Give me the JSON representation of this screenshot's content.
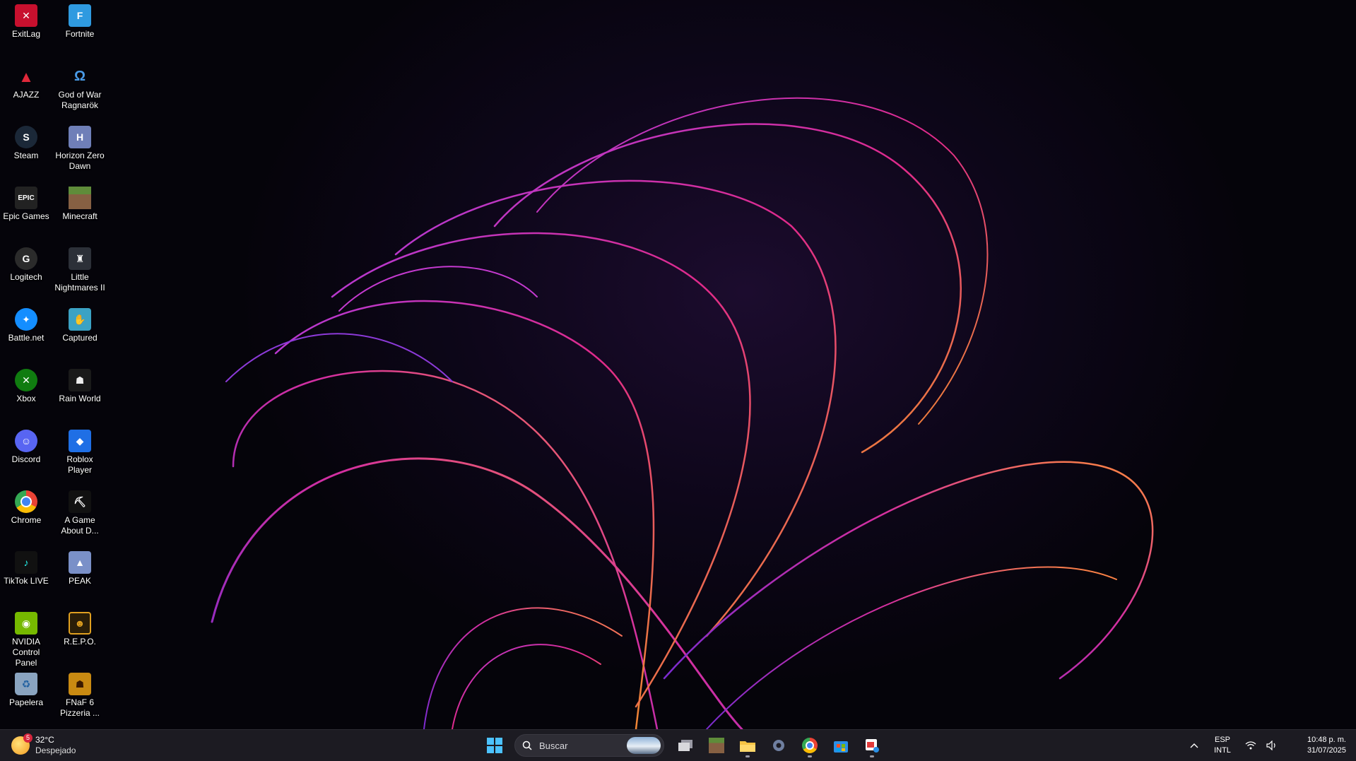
{
  "desktop_icons": [
    {
      "label": "ExitLag",
      "icon": "exitlag-icon",
      "color": "#c8102e"
    },
    {
      "label": "Fortnite",
      "icon": "fortnite-icon",
      "color": "#2f9ae0"
    },
    {
      "label": "AJAZZ",
      "icon": "ajazz-icon",
      "color": "#b3162a"
    },
    {
      "label": "God of War Ragnarök",
      "icon": "god-of-war-icon",
      "color": "#1f4f8c"
    },
    {
      "label": "Steam",
      "icon": "steam-icon",
      "color": "#1b2838"
    },
    {
      "label": "Horizon Zero Dawn",
      "icon": "horizon-icon",
      "color": "#6f7fb8"
    },
    {
      "label": "Epic Games",
      "icon": "epic-games-icon",
      "color": "#222222"
    },
    {
      "label": "Minecraft",
      "icon": "minecraft-icon",
      "color": "#5f8c3a"
    },
    {
      "label": "Logitech",
      "icon": "logitech-icon",
      "color": "#2b2b2b"
    },
    {
      "label": "Little Nightmares II",
      "icon": "little-nightmares-icon",
      "color": "#2c3038"
    },
    {
      "label": "Battle.net",
      "icon": "battlenet-icon",
      "color": "#148eff"
    },
    {
      "label": "Captured",
      "icon": "captured-icon",
      "color": "#3ba2c4"
    },
    {
      "label": "Xbox",
      "icon": "xbox-icon",
      "color": "#107c10"
    },
    {
      "label": "Rain World",
      "icon": "rain-world-icon",
      "color": "#1a1a1a"
    },
    {
      "label": "Discord",
      "icon": "discord-icon",
      "color": "#5865f2"
    },
    {
      "label": "Roblox Player",
      "icon": "roblox-icon",
      "color": "#1f6fe5"
    },
    {
      "label": "Chrome",
      "icon": "chrome-icon",
      "color": "#e0e0e0"
    },
    {
      "label": "A Game About D...",
      "icon": "a-game-about-icon",
      "color": "#111111"
    },
    {
      "label": "TikTok LIVE",
      "icon": "tiktok-live-icon",
      "color": "#111111"
    },
    {
      "label": "PEAK",
      "icon": "peak-icon",
      "color": "#7a90c8"
    },
    {
      "label": "NVIDIA Control Panel",
      "icon": "nvidia-icon",
      "color": "#76b900"
    },
    {
      "label": "R.E.P.O.",
      "icon": "repo-icon",
      "color": "#e0a020"
    },
    {
      "label": "Papelera",
      "icon": "recycle-bin-icon",
      "color": "#8aa4c0"
    },
    {
      "label": "FNaF 6 Pizzeria ...",
      "icon": "fnaf-icon",
      "color": "#c98a12"
    }
  ],
  "taskbar": {
    "weather": {
      "temp": "32°C",
      "condition": "Despejado",
      "badge": "5"
    },
    "search": {
      "placeholder": "Buscar"
    },
    "apps": [
      {
        "name": "task-view-icon",
        "running": false
      },
      {
        "name": "minecraft-taskbar-icon",
        "running": false
      },
      {
        "name": "file-explorer-icon",
        "running": true
      },
      {
        "name": "settings-icon",
        "running": false
      },
      {
        "name": "chrome-taskbar-icon",
        "running": true
      },
      {
        "name": "microsoft-store-icon",
        "running": false
      },
      {
        "name": "snipping-tool-icon",
        "running": true
      }
    ],
    "language": {
      "line1": "ESP",
      "line2": "INTL"
    },
    "clock": {
      "time": "10:48 p. m.",
      "date": "31/07/2025"
    }
  }
}
